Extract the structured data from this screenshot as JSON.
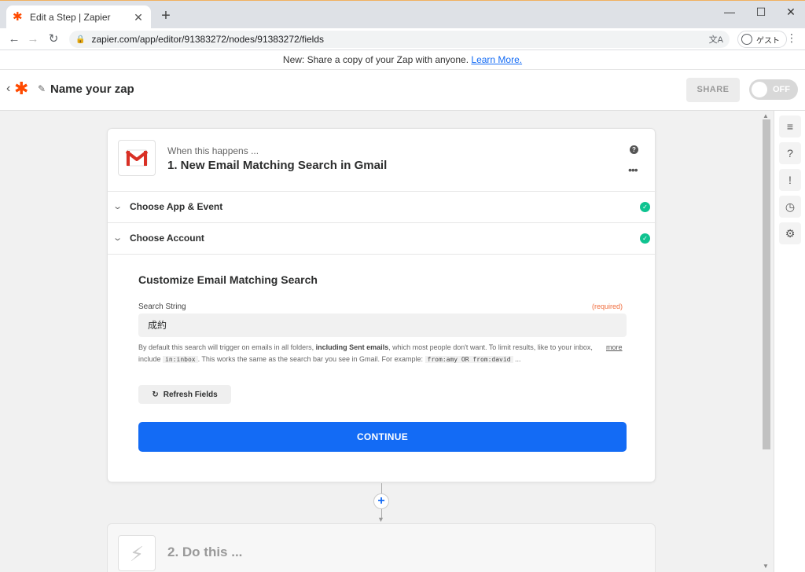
{
  "browser": {
    "tab_title": "Edit a Step | Zapier",
    "url": "zapier.com/app/editor/91383272/nodes/91383272/fields",
    "profile_label": "ゲスト"
  },
  "announcement": {
    "text": "New: Share a copy of your Zap with anyone.",
    "link": "Learn More."
  },
  "header": {
    "zap_name": "Name your zap",
    "share_label": "SHARE",
    "toggle_label": "OFF"
  },
  "step1": {
    "prefix": "When this happens ...",
    "title": "1. New Email Matching Search in Gmail",
    "sections": [
      {
        "label": "Choose App & Event"
      },
      {
        "label": "Choose Account"
      }
    ],
    "customize_title": "Customize Email Matching Search",
    "field_label": "Search String",
    "required_label": "(required)",
    "field_value": "成約",
    "help_part1": "By default this search will trigger on emails in all folders,",
    "help_bold": "including Sent emails",
    "help_part2": ", which most people don't want. To limit results, like to your inbox, include",
    "help_code1": "in:inbox",
    "help_part3": ". This works the same as the search bar you see in Gmail. For example:",
    "help_code2": "from:amy OR from:david",
    "help_ellipsis": "...",
    "more_label": "more",
    "refresh_label": "Refresh Fields",
    "continue_label": "CONTINUE"
  },
  "step2": {
    "title": "2. Do this ..."
  },
  "colors": {
    "accent": "#136bf5",
    "brand": "#ff4a00",
    "success": "#0fc390",
    "required": "#f06c3c"
  }
}
